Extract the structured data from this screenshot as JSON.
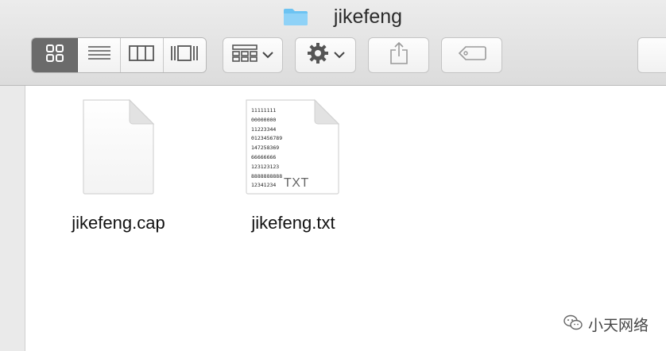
{
  "window": {
    "title": "jikefeng",
    "title_icon": "folder-icon"
  },
  "toolbar": {
    "view_modes": [
      {
        "name": "icon-view",
        "icon": "grid-icon",
        "selected": true
      },
      {
        "name": "list-view",
        "icon": "list-icon",
        "selected": false
      },
      {
        "name": "column-view",
        "icon": "columns-icon",
        "selected": false
      },
      {
        "name": "gallery-view",
        "icon": "gallery-icon",
        "selected": false
      }
    ],
    "arrange_icon": "arrange-grid-icon",
    "action_icon": "gear-icon",
    "share_icon": "share-icon",
    "tags_icon": "tag-icon"
  },
  "files": [
    {
      "name": "jikefeng.cap",
      "icon": "blank-document-icon"
    },
    {
      "name": "jikefeng.txt",
      "icon": "text-document-icon",
      "preview_lines": [
        "11111111",
        "00000000",
        "11223344",
        "0123456789",
        "147258369",
        "66666666",
        "123123123",
        "8888888888",
        "12341234"
      ],
      "extension_label": "TXT"
    }
  ],
  "watermark": {
    "text": "小天网络",
    "icon": "wechat-icon"
  },
  "colors": {
    "folder_blue": "#6cc3f2",
    "selected_segment": "#6b6b6b",
    "toolbar_bg": "#e3e3e3"
  }
}
